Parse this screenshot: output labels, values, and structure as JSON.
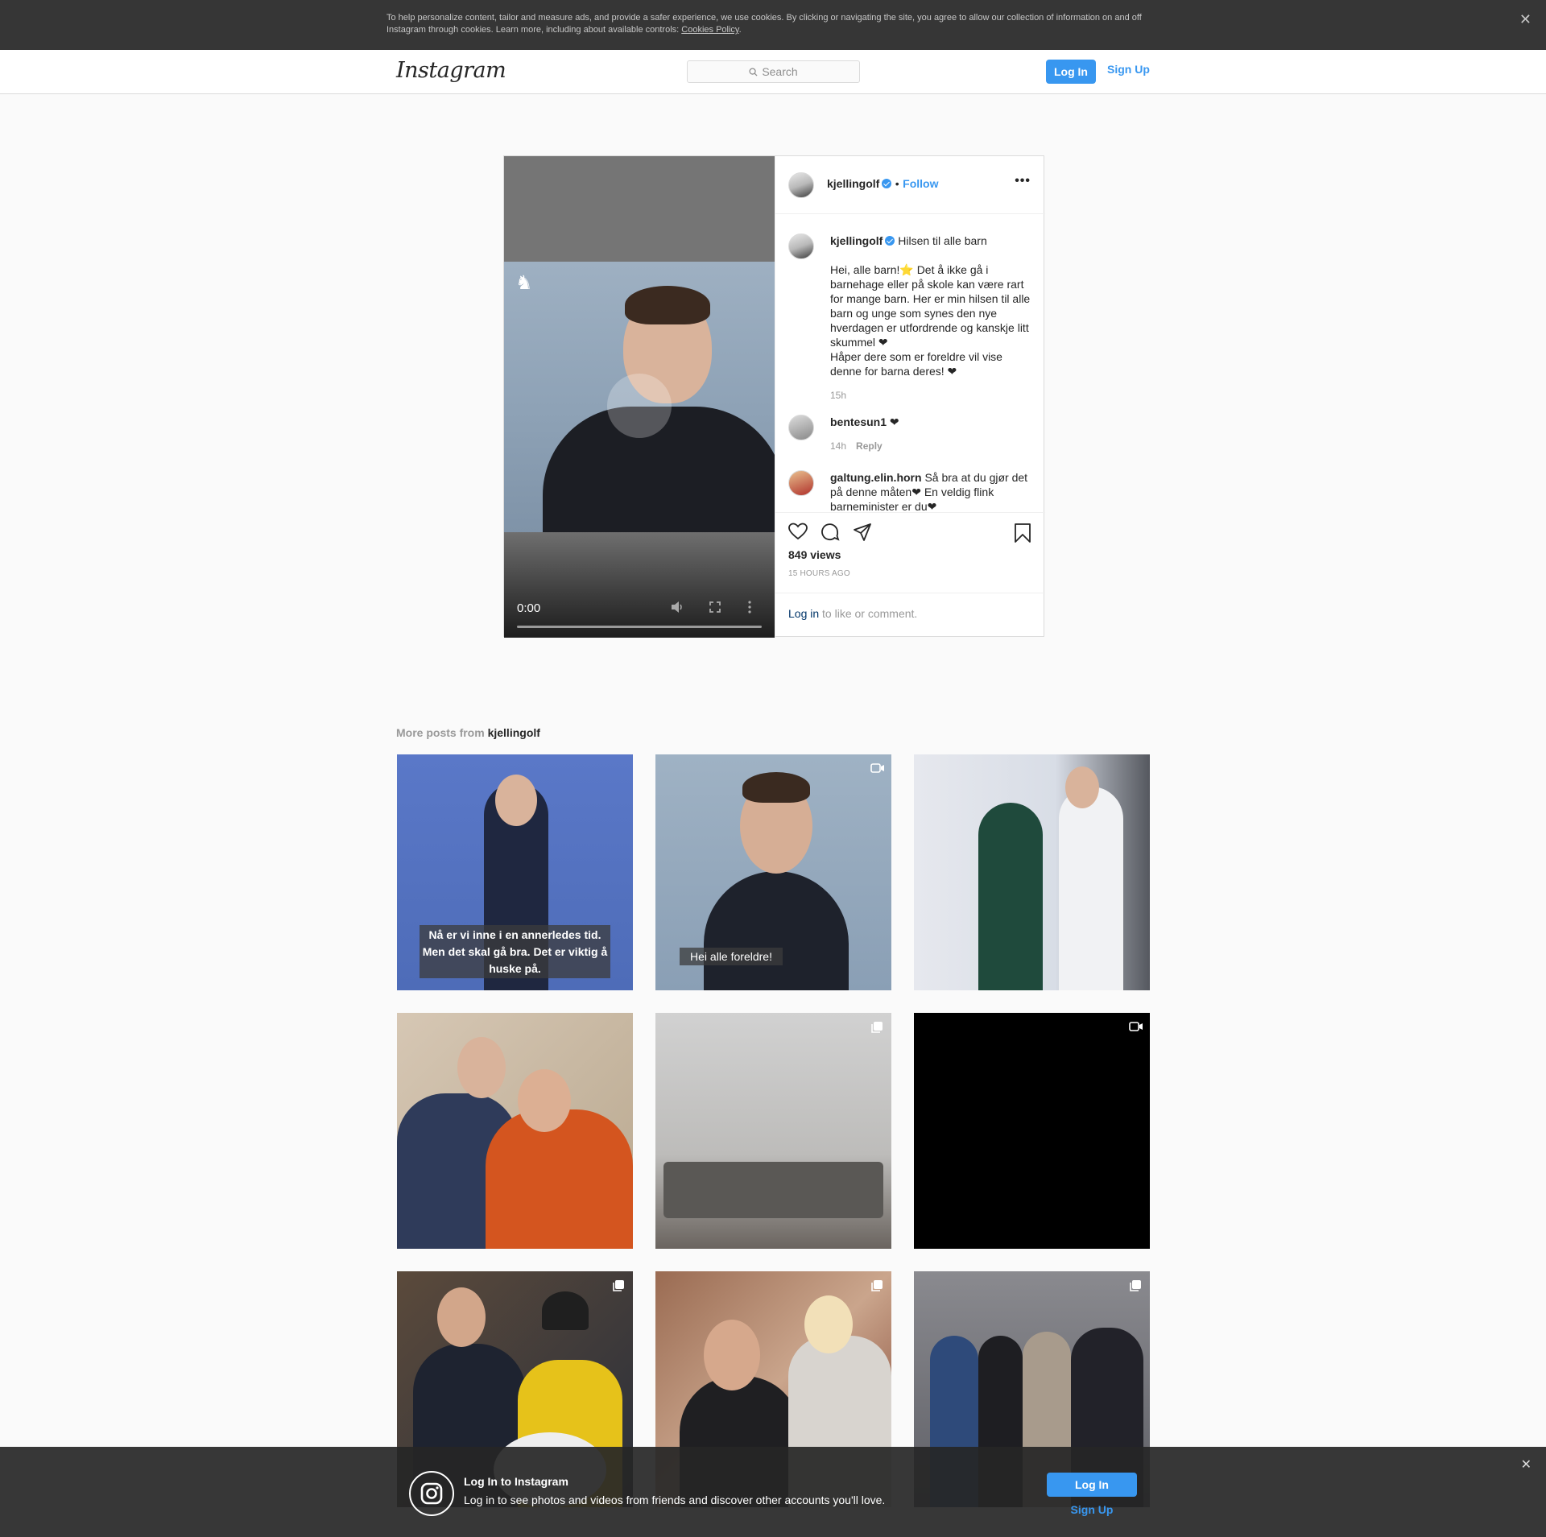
{
  "cookie_banner": {
    "text": "To help personalize content, tailor and measure ads, and provide a safer experience, we use cookies. By clicking or navigating the site, you agree to allow our collection of information on and off Instagram through cookies. Learn more, including about available controls: ",
    "link": "Cookies Policy",
    "end": ".",
    "close_icon": "close-icon"
  },
  "nav": {
    "logo": "Instagram",
    "search_placeholder": "Search",
    "login": "Log In",
    "signup": "Sign Up"
  },
  "post": {
    "username": "kjellingolf",
    "separator": "•",
    "follow": "Follow",
    "more": "•••",
    "video": {
      "time": "0:00"
    },
    "caption": {
      "username": "kjellingolf",
      "title": "Hilsen til alle barn",
      "body_lines": [
        "Hei, alle barn!⭐ Det å ikke gå i barnehage eller på skole kan være rart for mange barn. Her er min hilsen til alle barn og unge som synes den nye hverdagen er utfordrende og kanskje litt skummel ❤",
        "Håper dere som er foreldre vil vise denne for barna deres! ❤"
      ],
      "time": "15h"
    },
    "comments": [
      {
        "username": "bentesun1",
        "text": "❤",
        "time": "14h",
        "reply": "Reply"
      },
      {
        "username": "galtung.elin.horn",
        "text": "Så bra at du gjør det på denne måten❤ En veldig flink barneminister er du❤"
      }
    ],
    "views": "849 views",
    "ago": "15 HOURS AGO",
    "login_prompt_link": "Log in",
    "login_prompt_rest": " to like or comment."
  },
  "more_posts": {
    "label": "More posts from ",
    "username": "kjellingolf",
    "tiles": [
      {
        "type": "image",
        "caption": "Nå er vi inne i en annerledes tid. Men det skal gå bra. Det er viktig å huske på."
      },
      {
        "type": "video",
        "caption": "Hei alle foreldre!"
      },
      {
        "type": "image"
      },
      {
        "type": "image"
      },
      {
        "type": "carousel"
      },
      {
        "type": "video"
      },
      {
        "type": "carousel"
      },
      {
        "type": "carousel"
      },
      {
        "type": "carousel"
      }
    ]
  },
  "bottom_bar": {
    "title": "Log In to Instagram",
    "text": "Log in to see photos and videos from friends and discover other accounts you'll love.",
    "login": "Log In",
    "signup": "Sign Up"
  },
  "colors": {
    "accent": "#3897f0",
    "cookie_bg": "#363636",
    "page_bg": "#fafafa"
  }
}
